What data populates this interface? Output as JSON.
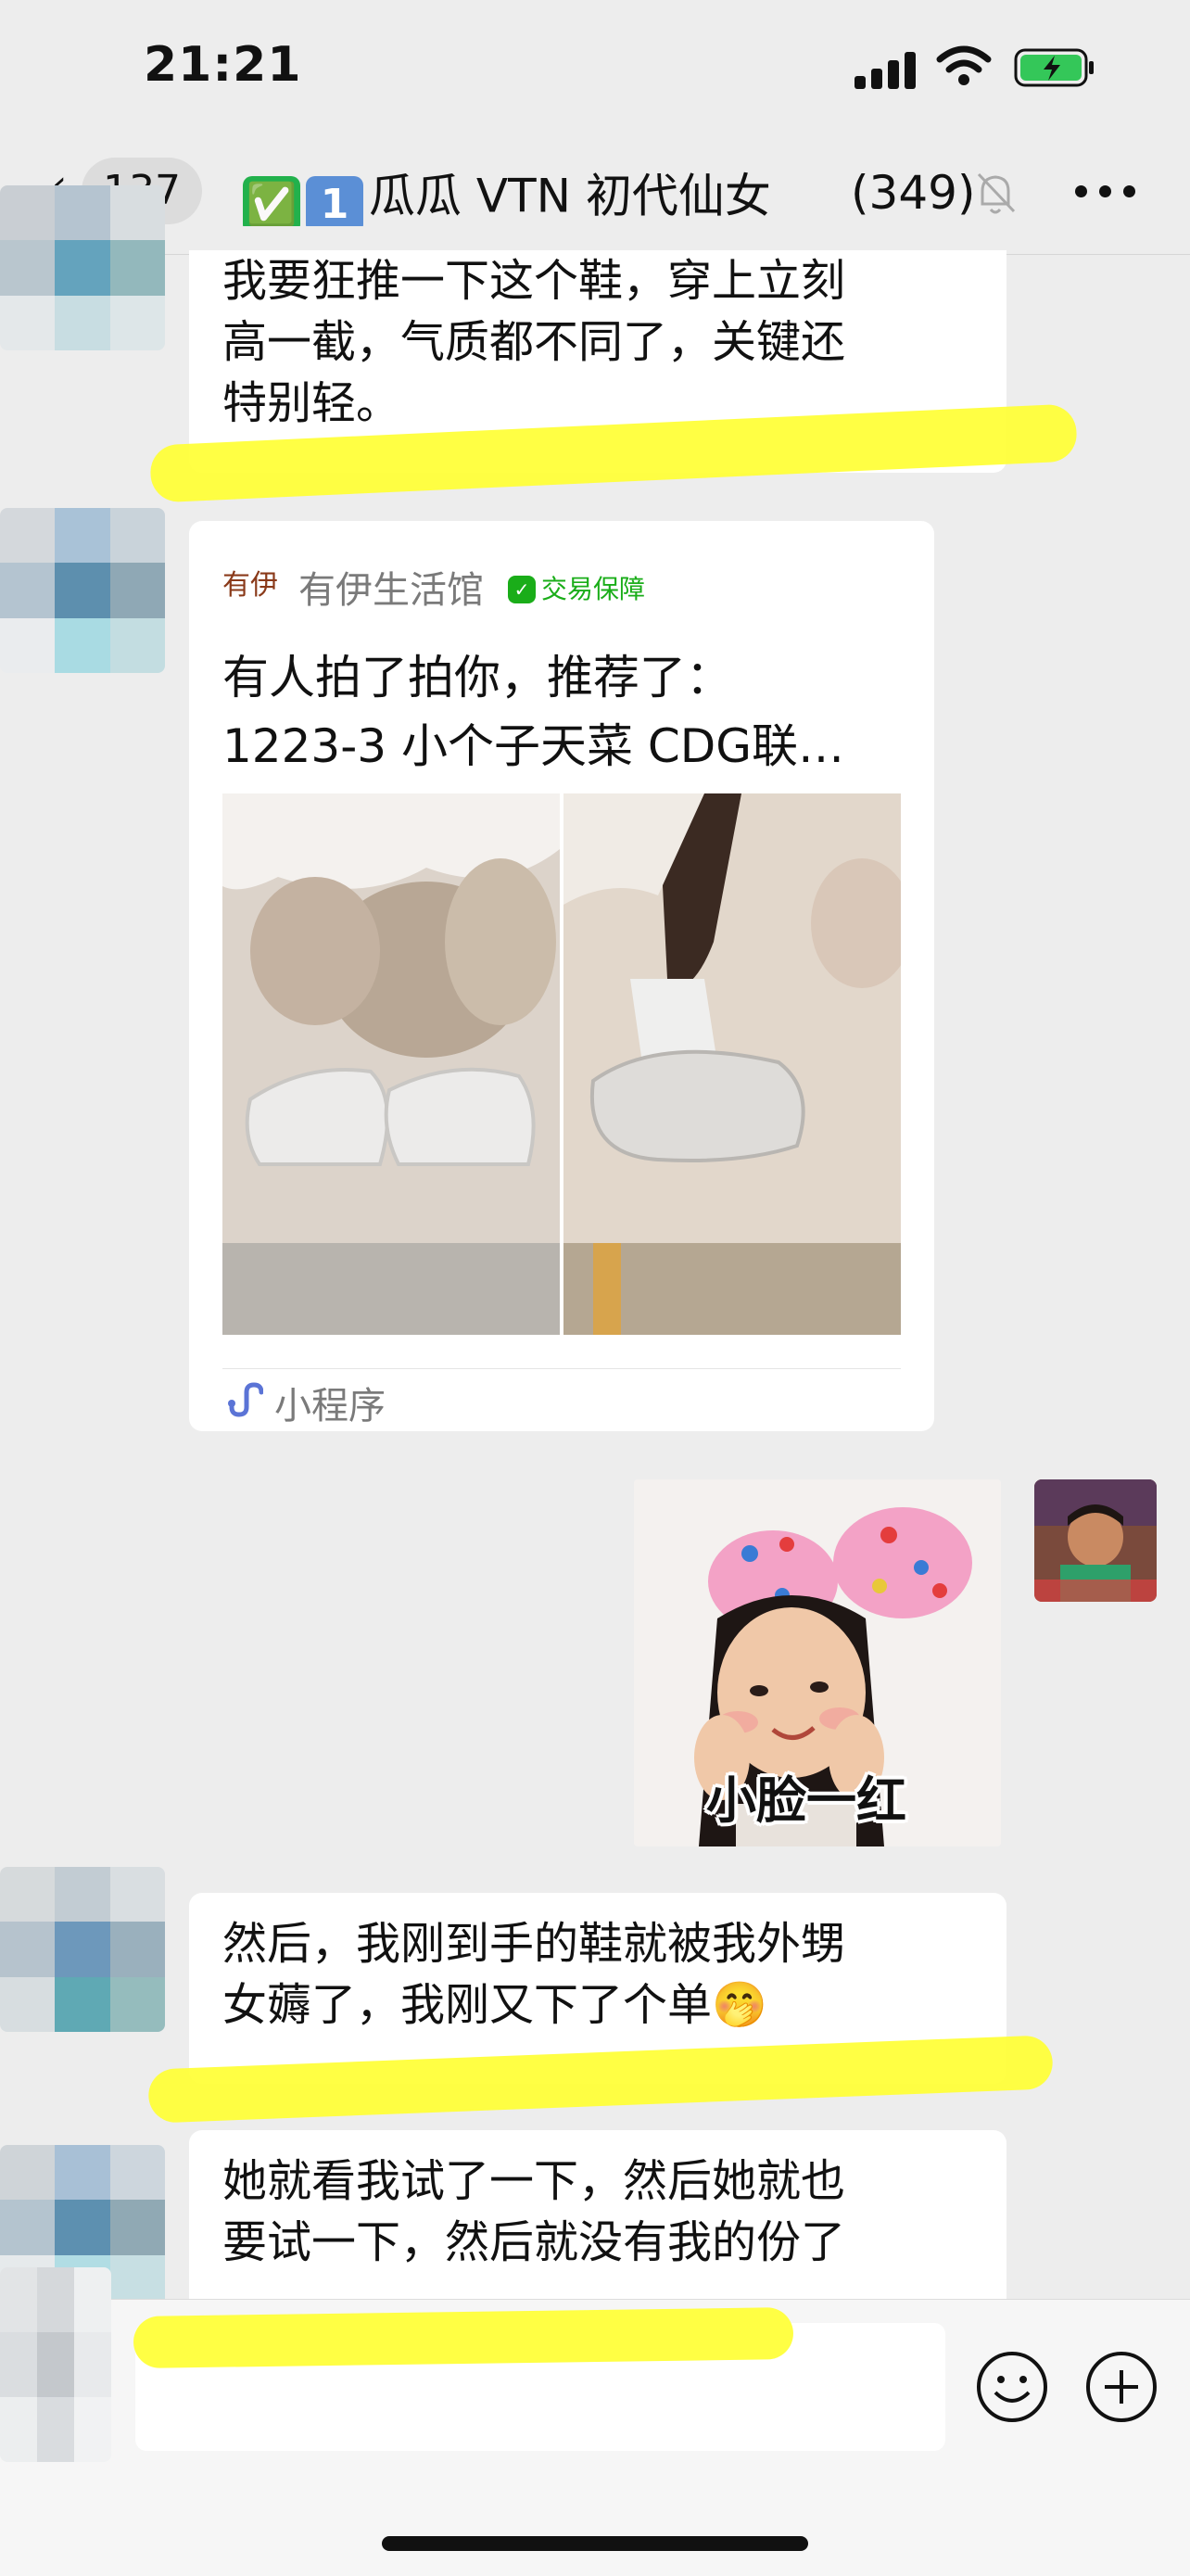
{
  "status_bar": {
    "time": "21:21"
  },
  "nav": {
    "unread_count": "137",
    "title_emoji_1": "✅",
    "title_emoji_2": "1",
    "title": "瓜瓜 VTN 初代仙女",
    "member_count": "(349)",
    "icons": [
      "back-chevron-icon",
      "bell-muted-icon",
      "more-icon"
    ]
  },
  "messages": {
    "m1": {
      "lines": [
        "我要狂推一下这个鞋，穿上立刻",
        "高一截，气质都不同了，关键还",
        "特别轻。"
      ]
    },
    "card": {
      "shop_logo": "有伊",
      "shop_name": "有伊生活馆",
      "guarantee": "交易保障",
      "line1": "有人拍了拍你，推荐了：",
      "line2": "1223-3 小个子天菜 CDG联…",
      "footer": "小程序"
    },
    "sticker": {
      "caption": "小脸一红"
    },
    "m2": {
      "lines": [
        "然后，我刚到手的鞋就被我外甥",
        "女薅了，我刚又下了个单🤭"
      ]
    },
    "m3": {
      "lines": [
        "她就看我试了一下，然后她就也",
        "要试一下，然后就没有我的份了"
      ]
    }
  },
  "input_bar": {
    "value": "",
    "icons": [
      "voice-icon",
      "emoji-icon",
      "plus-icon"
    ]
  },
  "colors": {
    "background": "#ededed",
    "bubble": "#ffffff",
    "highlight": "#ffff3a",
    "wechat_green": "#1aad19"
  }
}
